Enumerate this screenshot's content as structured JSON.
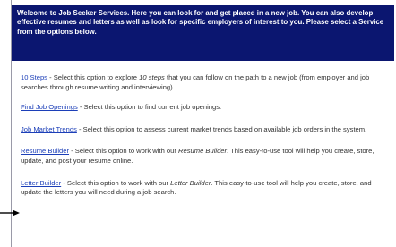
{
  "intro": "Welcome to Job Seeker Services. Here you can look for and get placed in a new job. You can also develop effective resumes and letters as well as look for specific employers of interest to you. Please select a Service from the options below.",
  "options": [
    {
      "link": "10 Steps",
      "text_parts": [
        " - Select this option to explore ",
        "10 steps",
        " that you can follow on the path to a new job (from employer and job searches through resume writing and interviewing)."
      ]
    },
    {
      "link": "Find Job Openings",
      "text_parts": [
        " - Select this option to find current job openings."
      ]
    },
    {
      "link": "Job Market Trends",
      "text_parts": [
        " - Select this option to assess current market trends based on available job orders in the system."
      ]
    },
    {
      "link": "Resume Builder",
      "text_parts": [
        " - Select this option to work with our ",
        "Resume Builder",
        ". This easy-to-use tool will help you create, store, update, and post your resume online."
      ]
    },
    {
      "link": "Letter Builder",
      "text_parts": [
        " - Select this option to work with our ",
        "Letter Builder",
        ". This easy-to-use tool will help you create, store, and update the letters you will need during a job search."
      ]
    }
  ],
  "colors": {
    "banner_bg": "#0b1670",
    "banner_text": "#ffffff",
    "link": "#1c3fb8",
    "body_text": "#333333"
  },
  "icons": {
    "pointer": "arrow-right-icon"
  }
}
